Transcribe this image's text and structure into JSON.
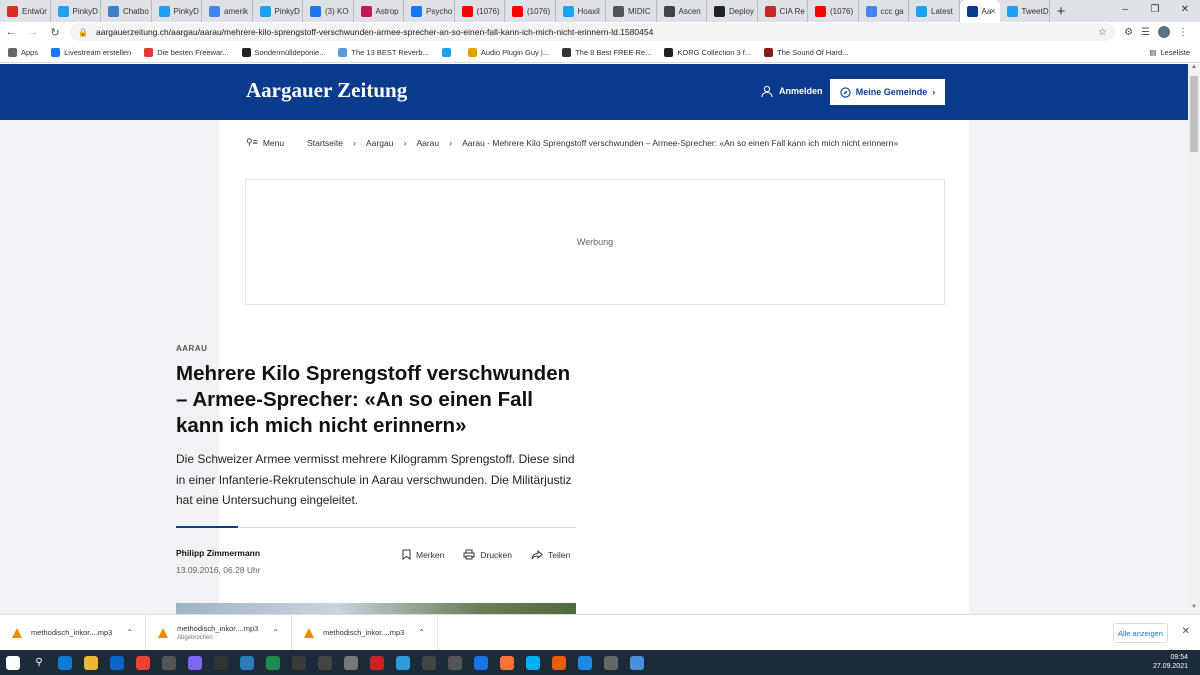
{
  "browser": {
    "tabs": [
      {
        "label": "Entwür",
        "icon": "gmail-icon",
        "color": "#d93025"
      },
      {
        "label": "PinkyD",
        "icon": "twitter-icon",
        "color": "#1da1f2"
      },
      {
        "label": "Chatbo",
        "icon": "star-icon",
        "color": "#3b82c4"
      },
      {
        "label": "PinkyD",
        "icon": "twitter-icon",
        "color": "#1da1f2"
      },
      {
        "label": "amerik",
        "icon": "google-icon",
        "color": "#4285f4"
      },
      {
        "label": "PinkyD",
        "icon": "twitter-icon",
        "color": "#1da1f2"
      },
      {
        "label": "(3) KO",
        "icon": "facebook-icon",
        "color": "#1877f2"
      },
      {
        "label": "Astrop",
        "icon": "astro-icon",
        "color": "#c2185b"
      },
      {
        "label": "Psycho",
        "icon": "facebook-icon",
        "color": "#1877f2"
      },
      {
        "label": "(1076)",
        "icon": "youtube-icon",
        "color": "#ff0000"
      },
      {
        "label": "(1076)",
        "icon": "youtube-icon",
        "color": "#ff0000"
      },
      {
        "label": "Hoaxil",
        "icon": "twitter-icon",
        "color": "#1da1f2"
      },
      {
        "label": "MIDIC",
        "icon": "page-icon",
        "color": "#555555"
      },
      {
        "label": "Ascen",
        "icon": "page-icon",
        "color": "#444444"
      },
      {
        "label": "Deploy",
        "icon": "github-icon",
        "color": "#222222"
      },
      {
        "label": "CIA Re",
        "icon": "cia-icon",
        "color": "#c62828"
      },
      {
        "label": "(1076)",
        "icon": "youtube-icon",
        "color": "#ff0000"
      },
      {
        "label": "ccc ga",
        "icon": "google-icon",
        "color": "#4285f4"
      },
      {
        "label": "Latest",
        "icon": "twitter-icon",
        "color": "#1da1f2"
      },
      {
        "label": "Aa",
        "icon": "az-icon",
        "color": "#0b3b8c",
        "active": true
      },
      {
        "label": "TweetD",
        "icon": "tweetdeck-icon",
        "color": "#1da1f2"
      }
    ],
    "url": "aargauerzeitung.ch/aargau/aarau/mehrere-kilo-sprengstoff-verschwunden-armee-sprecher-an-so-einen-fall-kann-ich-mich-nicht-erinnern-ld.1580454",
    "bookmarks": [
      {
        "label": "Apps",
        "icon": "apps-icon",
        "color": "#666666"
      },
      {
        "label": "Livestream erstellen",
        "icon": "facebook-icon",
        "color": "#1877f2"
      },
      {
        "label": "Die besten Freewar...",
        "icon": "star-icon",
        "color": "#e53935"
      },
      {
        "label": "Sondermülldeponie...",
        "icon": "wiki-icon",
        "color": "#222222"
      },
      {
        "label": "The 13 BEST Reverb...",
        "icon": "plugin-icon",
        "color": "#5b9bd5"
      },
      {
        "label": "",
        "icon": "twitter-icon",
        "color": "#1da1f2"
      },
      {
        "label": "Audio Plugin Guy |...",
        "icon": "plugin-icon",
        "color": "#e0a000"
      },
      {
        "label": "The 8 Best FREE Re...",
        "icon": "page-icon",
        "color": "#333333"
      },
      {
        "label": "KORG Collection 3 f...",
        "icon": "korg-icon",
        "color": "#222222"
      },
      {
        "label": "The Sound Of Hard...",
        "icon": "page-icon",
        "color": "#8b1a1a"
      }
    ],
    "reading_list": "Leseliste"
  },
  "site": {
    "logo": "Aargauer Zeitung",
    "login": "Anmelden",
    "gemeinde_button": "Meine Gemeinde",
    "brand_color": "#0b3b8c"
  },
  "breadcrumbs": {
    "menu": "Menu",
    "items": [
      "Startseite",
      "Aargau",
      "Aarau",
      "Aarau - Mehrere Kilo Sprengstoff verschwunden – Armee-Sprecher: «An so einen Fall kann ich mich nicht erinnern»"
    ]
  },
  "ad_label": "Werbung",
  "article": {
    "kicker": "AARAU",
    "headline": "Mehrere Kilo Sprengstoff verschwunden – Armee-Sprecher: «An so einen Fall kann ich mich nicht erinnern»",
    "lead": "Die Schweizer Armee vermisst mehrere Kilogramm Sprengstoff. Diese sind in einer Infanterie-Rekrutenschule in Aarau verschwunden. Die Militärjustiz hat eine Untersuchung eingeleitet.",
    "author": "Philipp Zimmermann",
    "date": "13.09.2016, 06.28 Uhr",
    "actions": {
      "save": "Merken",
      "print": "Drucken",
      "share": "Teilen"
    }
  },
  "downloads": {
    "items": [
      {
        "name": "methodisch_inkor....mp3",
        "status": ""
      },
      {
        "name": "methodisch_inkor....mp3",
        "status": "Abgebrochen"
      },
      {
        "name": "methodisch_inkor....mp3",
        "status": ""
      }
    ],
    "show_all": "Alle anzeigen"
  },
  "taskbar": {
    "time": "09:54",
    "date": "27.09.2021"
  }
}
